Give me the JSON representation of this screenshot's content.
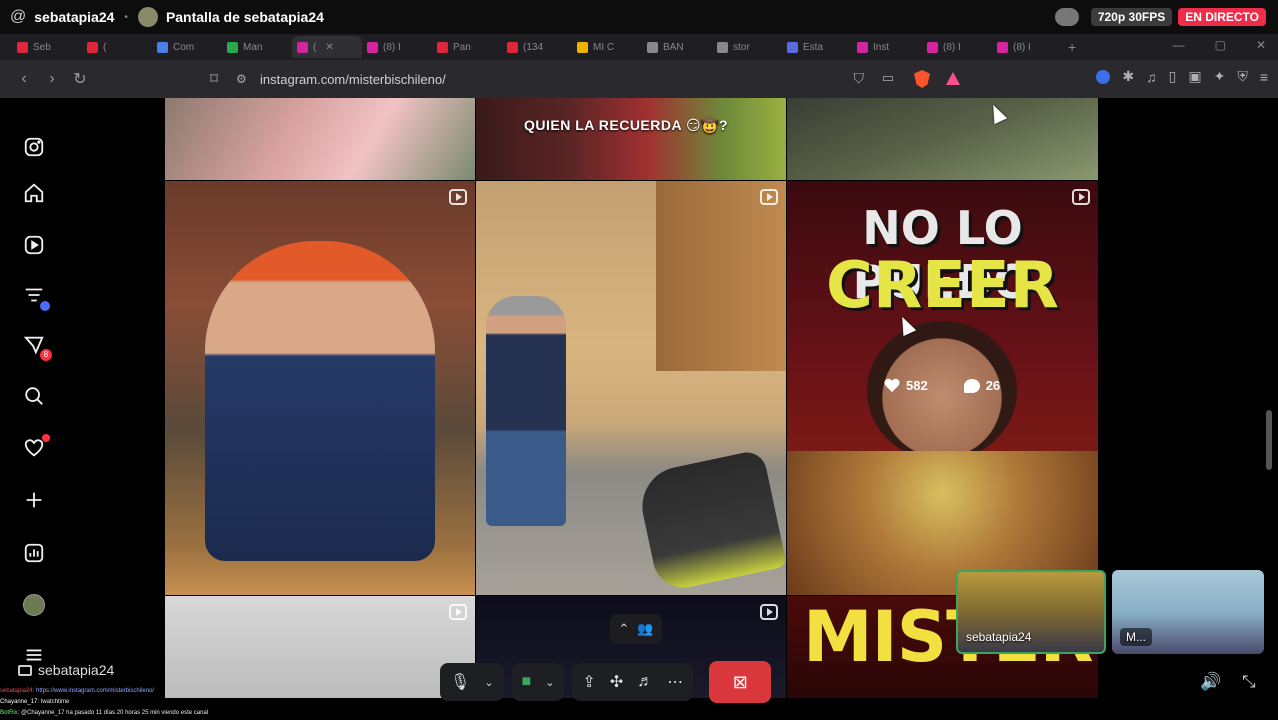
{
  "stream": {
    "at_symbol": "@",
    "username": "sebatapia24",
    "dot": "•",
    "screen_title": "Pantalla de sebatapia24",
    "quality": "720p 30FPS",
    "live_label": "EN DIRECTO"
  },
  "tabs": [
    {
      "label": "Seb",
      "color": "#e0263a"
    },
    {
      "label": "(",
      "color": "#e0263a"
    },
    {
      "label": "Com",
      "color": "#4a7ee8"
    },
    {
      "label": "Man",
      "color": "#2aa84a"
    },
    {
      "label": "(",
      "color": "#d6249f",
      "active": true
    },
    {
      "label": "(8) I",
      "color": "#d6249f"
    },
    {
      "label": "Pan",
      "color": "#e0263a"
    },
    {
      "label": "(134",
      "color": "#e0263a"
    },
    {
      "label": "MI C",
      "color": "#f0b400"
    },
    {
      "label": "BAN",
      "color": "#888888"
    },
    {
      "label": "stor",
      "color": "#888888"
    },
    {
      "label": "Esta",
      "color": "#5a6ae0"
    },
    {
      "label": "Inst",
      "color": "#d6249f"
    },
    {
      "label": "(8) I",
      "color": "#d6249f"
    },
    {
      "label": "(8) I",
      "color": "#d6249f"
    }
  ],
  "browser": {
    "url": "instagram.com/misterbischileno/",
    "back_icon": "‹",
    "forward_icon": "›",
    "reload_icon": "↻",
    "bookmark_icon": "⌑",
    "win_min": "—",
    "win_max": "▢",
    "win_close": "✕"
  },
  "sidebar": {
    "messages_badge": "8"
  },
  "posts": {
    "caption_top_middle": "QUIEN LA RECUERDA 😏🤠?",
    "promo_line1": "NO LO PUEDO",
    "promo_line2": "CREER",
    "promo_bottom": "MISTER",
    "likes": "582",
    "comments": "26"
  },
  "participants": [
    {
      "name": "sebatapia24"
    },
    {
      "name": "M..."
    }
  ],
  "streamer_label": "sebatapia24",
  "chat": [
    {
      "name": "sebatapia24",
      "text": ": https://www.instagram.com/misterbischileno/"
    },
    {
      "name": "Chayanne_17",
      "text": ": twatchtime"
    },
    {
      "name": "BotRix",
      "text": ": @Chayanne_17 ha pasado 11 días 20 horas 25 min viendo este canal"
    }
  ]
}
